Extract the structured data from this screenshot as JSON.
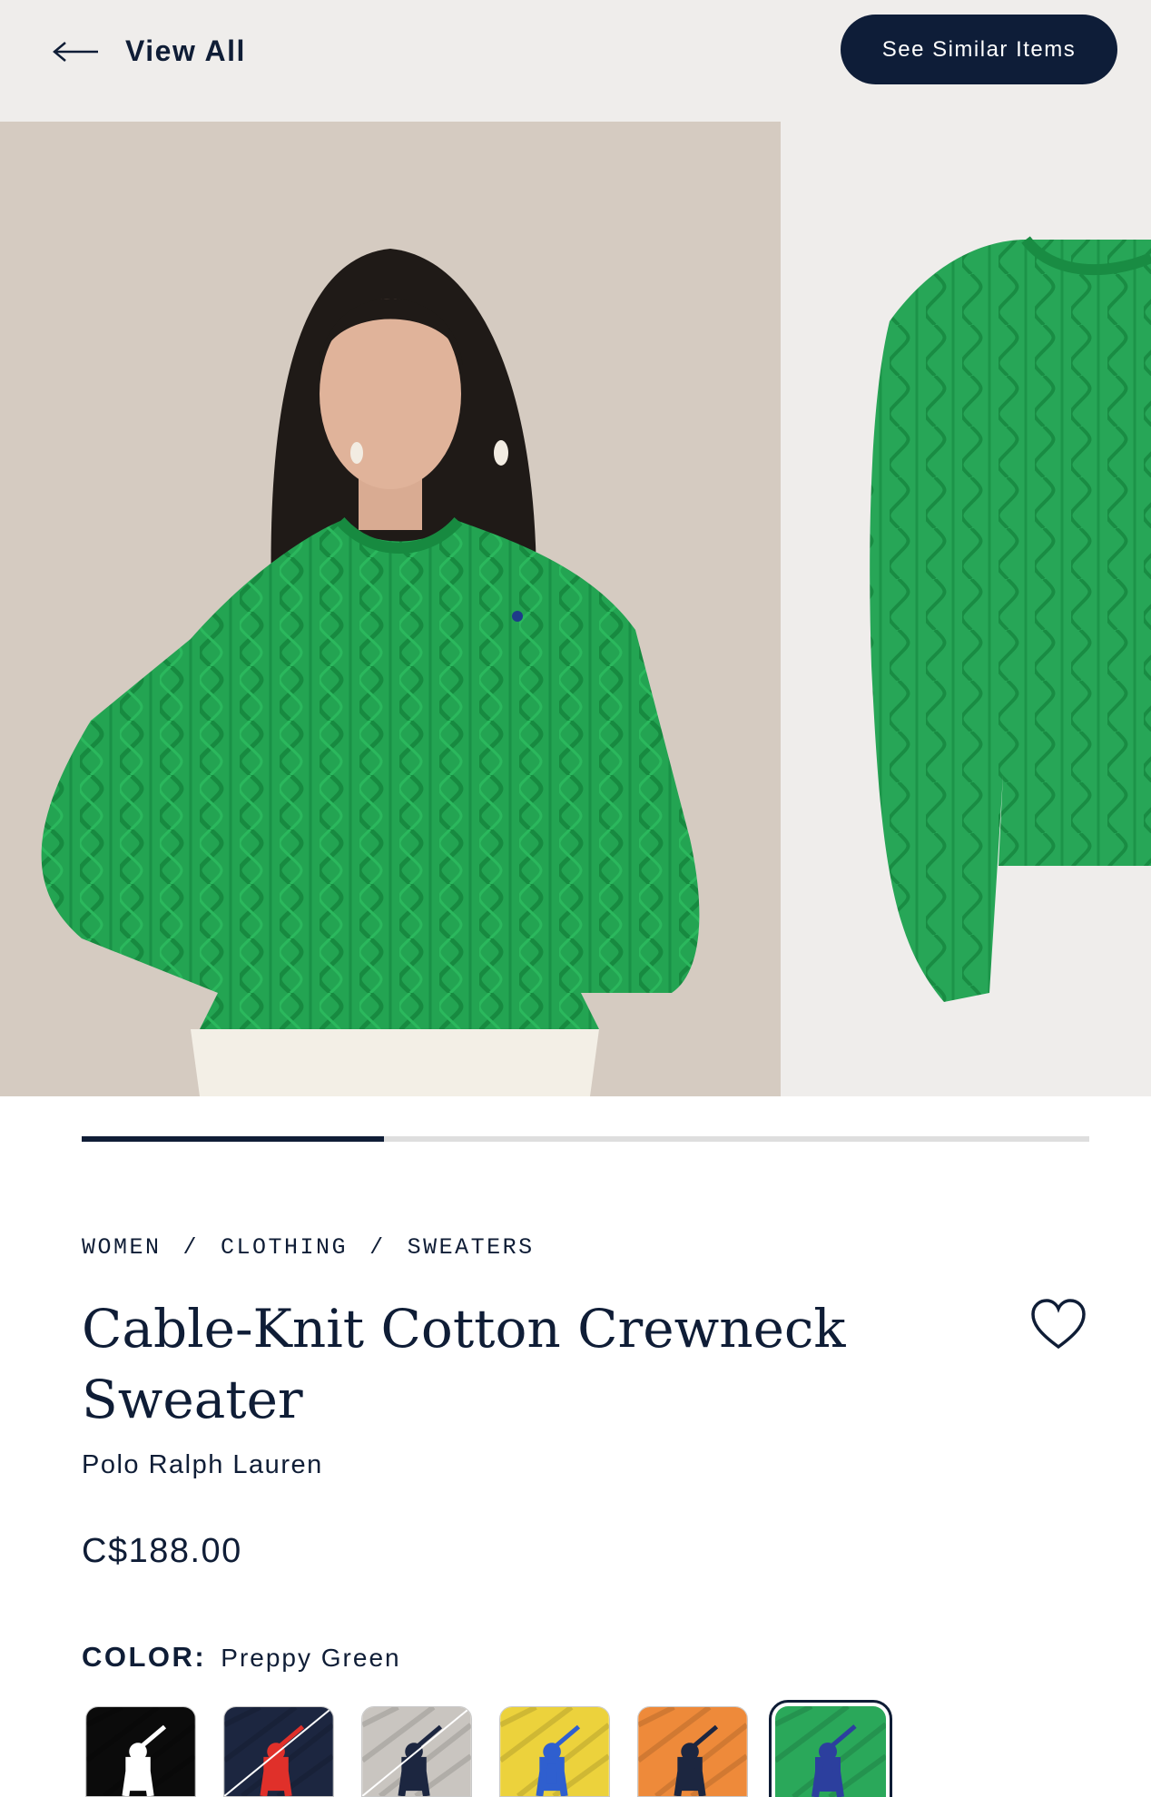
{
  "header": {
    "back_label": "View All",
    "similar_label": "See Similar Items"
  },
  "gallery": {
    "progress": 0.3
  },
  "breadcrumb": [
    "WOMEN",
    "CLOTHING",
    "SWEATERS"
  ],
  "product": {
    "title": "Cable-Knit Cotton Crewneck Sweater",
    "brand": "Polo Ralph Lauren",
    "price": "C$188.00"
  },
  "color": {
    "label": "COLOR:",
    "selected": "Preppy Green",
    "swatches": [
      {
        "name": "Black",
        "base": "#0b0b0b",
        "pony": "#ffffff",
        "unavailable": false
      },
      {
        "name": "Navy",
        "base": "#1c2640",
        "pony": "#e0302a",
        "unavailable": true
      },
      {
        "name": "Heather Grey",
        "base": "#c9c5c0",
        "pony": "#1c2640",
        "unavailable": true
      },
      {
        "name": "Yellow",
        "base": "#ecd23c",
        "pony": "#2f5fcf",
        "unavailable": false
      },
      {
        "name": "Orange",
        "base": "#ee8a3a",
        "pony": "#1c2640",
        "unavailable": false
      },
      {
        "name": "Preppy Green",
        "base": "#2aa85a",
        "pony": "#2c3f9e",
        "unavailable": false
      }
    ]
  }
}
